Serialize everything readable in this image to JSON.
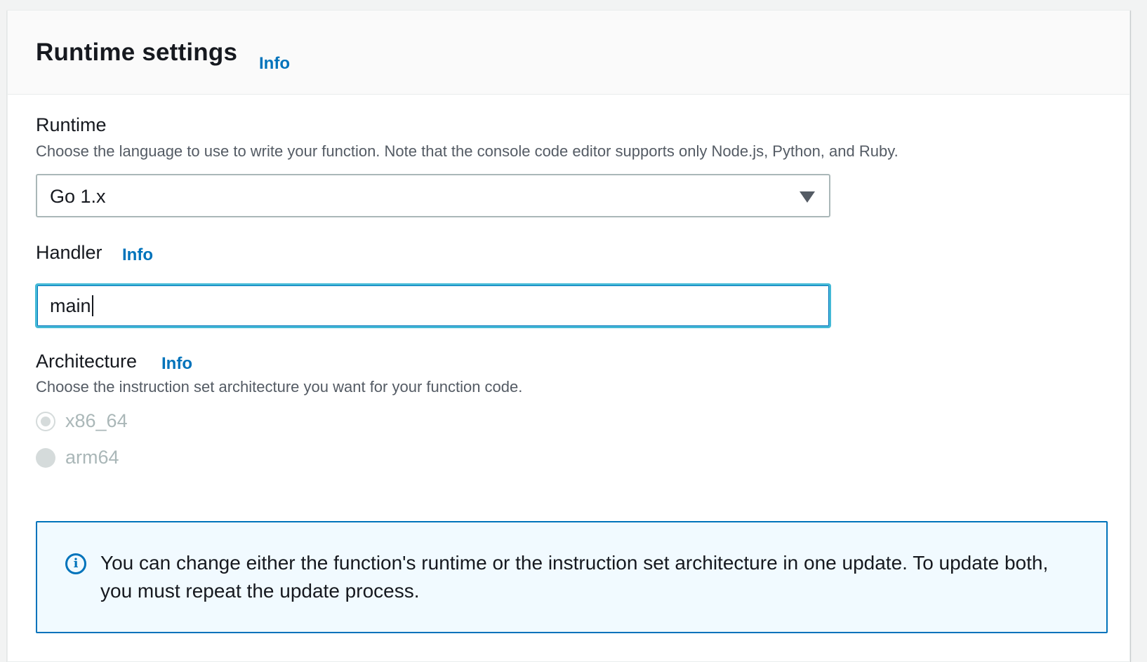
{
  "panel": {
    "title": "Runtime settings",
    "title_info": "Info"
  },
  "runtime": {
    "label": "Runtime",
    "description": "Choose the language to use to write your function. Note that the console code editor supports only Node.js, Python, and Ruby.",
    "selected": "Go 1.x"
  },
  "handler": {
    "label": "Handler",
    "info": "Info",
    "value": "main"
  },
  "architecture": {
    "label": "Architecture",
    "info": "Info",
    "description": "Choose the instruction set architecture you want for your function code.",
    "options": [
      {
        "label": "x86_64",
        "checked": true,
        "disabled": true
      },
      {
        "label": "arm64",
        "checked": false,
        "disabled": true
      }
    ]
  },
  "alert": {
    "icon": "info-icon",
    "text": "You can change either the function's runtime or the instruction set architecture in one update. To update both, you must repeat the update process."
  },
  "colors": {
    "accent": "#0073bb",
    "focus": "#44b9d6",
    "alert_bg": "#f1faff",
    "disabled": "#aab7b8"
  }
}
